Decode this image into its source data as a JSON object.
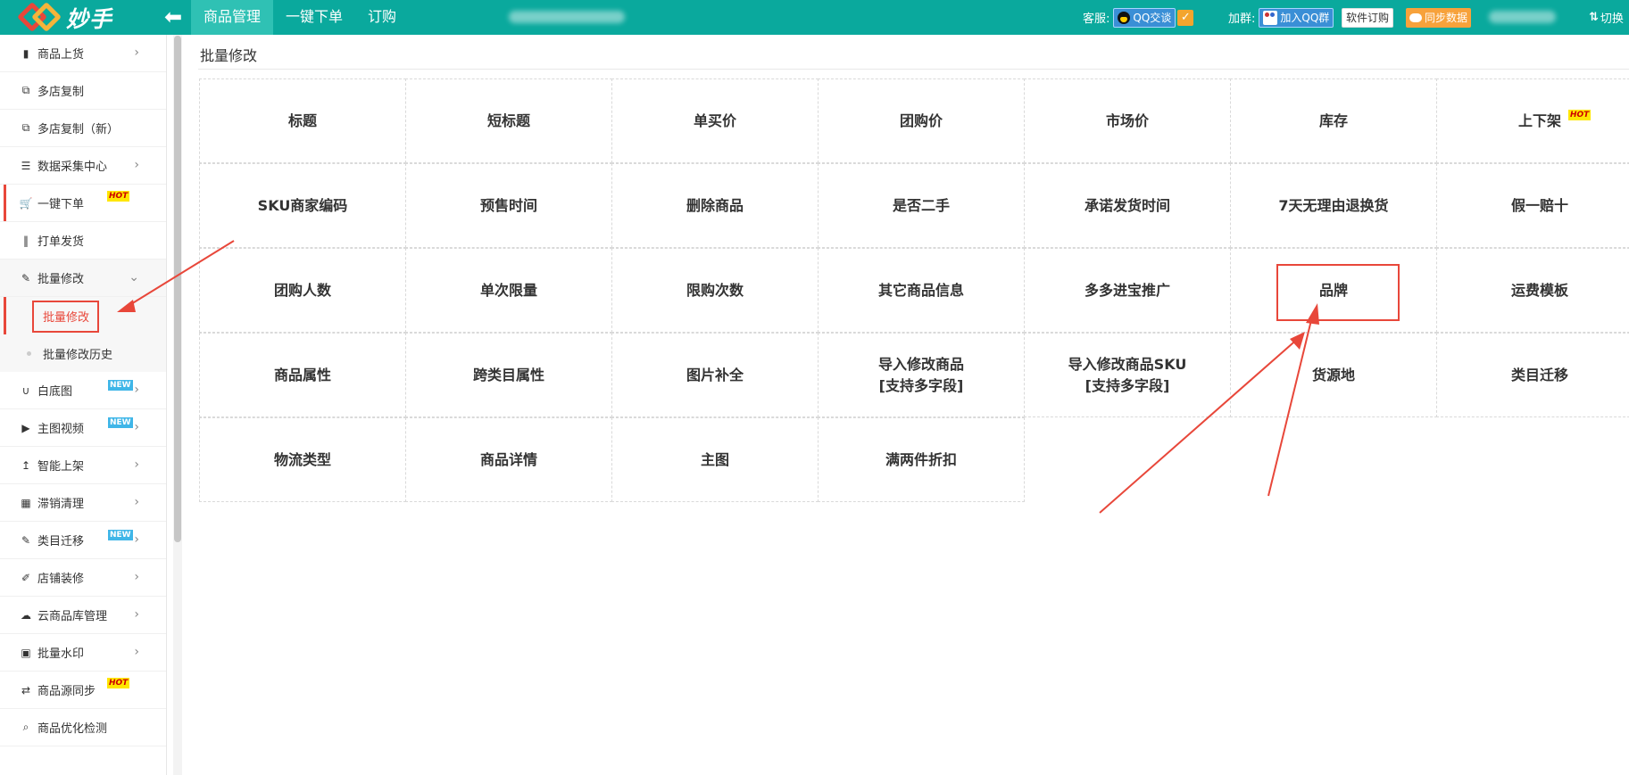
{
  "app": {
    "logo_text": "妙手"
  },
  "topnav": [
    "商品管理",
    "一键下单",
    "订购"
  ],
  "topright": {
    "service_label": "客服:",
    "qq_chat": "QQ交谈",
    "group_label": "加群:",
    "join_group": "加入QQ群",
    "software_order": "软件订购",
    "sync_data": "同步数据",
    "switch": "切换"
  },
  "sidebar": {
    "items": [
      {
        "label": "商品上货",
        "icon": "clipboard-icon",
        "chevron": "›"
      },
      {
        "label": "多店复制",
        "icon": "copy-icon",
        "chevron": ""
      },
      {
        "label": "多店复制（新）",
        "icon": "copy-icon",
        "chevron": ""
      },
      {
        "label": "数据采集中心",
        "icon": "database-icon",
        "chevron": "›"
      },
      {
        "label": "一键下单",
        "icon": "cart-icon",
        "chevron": "",
        "badge": "HOT"
      },
      {
        "label": "打单发货",
        "icon": "barcode-icon",
        "chevron": ""
      },
      {
        "label": "批量修改",
        "icon": "edit-icon",
        "chevron": "⌄",
        "open": true
      },
      {
        "label": "白底图",
        "icon": "magnet-icon",
        "chevron": "›",
        "badge": "NEW"
      },
      {
        "label": "主图视频",
        "icon": "play-icon",
        "chevron": "›",
        "badge": "NEW"
      },
      {
        "label": "智能上架",
        "icon": "arrow-up-icon",
        "chevron": "›"
      },
      {
        "label": "滞销清理",
        "icon": "calculator-icon",
        "chevron": "›"
      },
      {
        "label": "类目迁移",
        "icon": "edit-icon",
        "chevron": "›",
        "badge": "NEW"
      },
      {
        "label": "店铺装修",
        "icon": "brush-icon",
        "chevron": "›"
      },
      {
        "label": "云商品库管理",
        "icon": "cloud-icon",
        "chevron": "›"
      },
      {
        "label": "批量水印",
        "icon": "image-icon",
        "chevron": "›"
      },
      {
        "label": "商品源同步",
        "icon": "swap-icon",
        "chevron": "",
        "badge": "HOT"
      },
      {
        "label": "商品优化检测",
        "icon": "search-icon",
        "chevron": ""
      }
    ],
    "sub_items": [
      {
        "label": "批量修改",
        "active": true
      },
      {
        "label": "批量修改历史",
        "active": false
      }
    ]
  },
  "main": {
    "breadcrumb": "批量修改",
    "grid": [
      [
        {
          "label": "标题"
        },
        {
          "label": "短标题"
        },
        {
          "label": "单买价"
        },
        {
          "label": "团购价"
        },
        {
          "label": "市场价"
        },
        {
          "label": "库存"
        },
        {
          "label": "上下架",
          "badge": "HOT"
        }
      ],
      [
        {
          "label": "SKU商家编码"
        },
        {
          "label": "预售时间"
        },
        {
          "label": "删除商品"
        },
        {
          "label": "是否二手"
        },
        {
          "label": "承诺发货时间"
        },
        {
          "label": "7天无理由退换货"
        },
        {
          "label": "假一赔十"
        }
      ],
      [
        {
          "label": "团购人数"
        },
        {
          "label": "单次限量"
        },
        {
          "label": "限购次数"
        },
        {
          "label": "其它商品信息"
        },
        {
          "label": "多多进宝推广"
        },
        {
          "label": "品牌"
        },
        {
          "label": "运费模板"
        }
      ],
      [
        {
          "label": "商品属性"
        },
        {
          "label": "跨类目属性"
        },
        {
          "label": "图片补全"
        },
        {
          "label": "导入修改商品\n[支持多字段]"
        },
        {
          "label": "导入修改商品SKU\n[支持多字段]"
        },
        {
          "label": "货源地"
        },
        {
          "label": "类目迁移"
        }
      ],
      [
        {
          "label": "物流类型"
        },
        {
          "label": "商品详情"
        },
        {
          "label": "主图"
        },
        {
          "label": "满两件折扣"
        }
      ]
    ]
  },
  "colors": {
    "topbar": "#0aa99d",
    "accent_red": "#e8473a",
    "hot_bg": "#ffe600",
    "new_bg": "#3fb6e8"
  }
}
